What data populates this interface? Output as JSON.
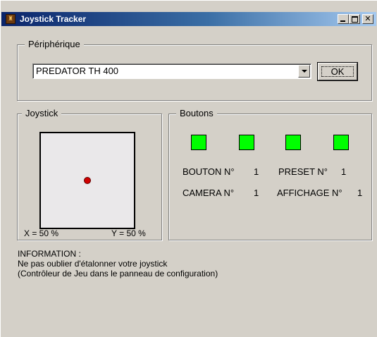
{
  "window": {
    "title": "Joystick Tracker",
    "controls": {
      "minimize": "",
      "maximize": "",
      "close": "✕"
    },
    "icon": "joystick-app-icon"
  },
  "peripheral": {
    "legend": "Périphérique",
    "selected_device": "PREDATOR TH 400",
    "ok_label": "OK"
  },
  "joystick": {
    "legend": "Joystick",
    "x_readout": "X = 50 %",
    "y_readout": "Y = 50 %",
    "x_percent": 50,
    "y_percent": 50,
    "dot_color": "#d00000"
  },
  "buttons": {
    "legend": "Boutons",
    "led_color": "#00ff00",
    "leds": [
      true,
      true,
      true,
      true
    ],
    "bouton_label": "BOUTON N°",
    "bouton_value": "1",
    "preset_label": "PRESET N°",
    "preset_value": "1",
    "camera_label": "CAMERA N°",
    "camera_value": "1",
    "affichage_label": "AFFICHAGE N°",
    "affichage_value": "1"
  },
  "info": {
    "heading": "INFORMATION :",
    "line1": "Ne pas oublier d'étalonner votre joystick",
    "line2": "(Contrôleur de Jeu dans le panneau de configuration)"
  }
}
